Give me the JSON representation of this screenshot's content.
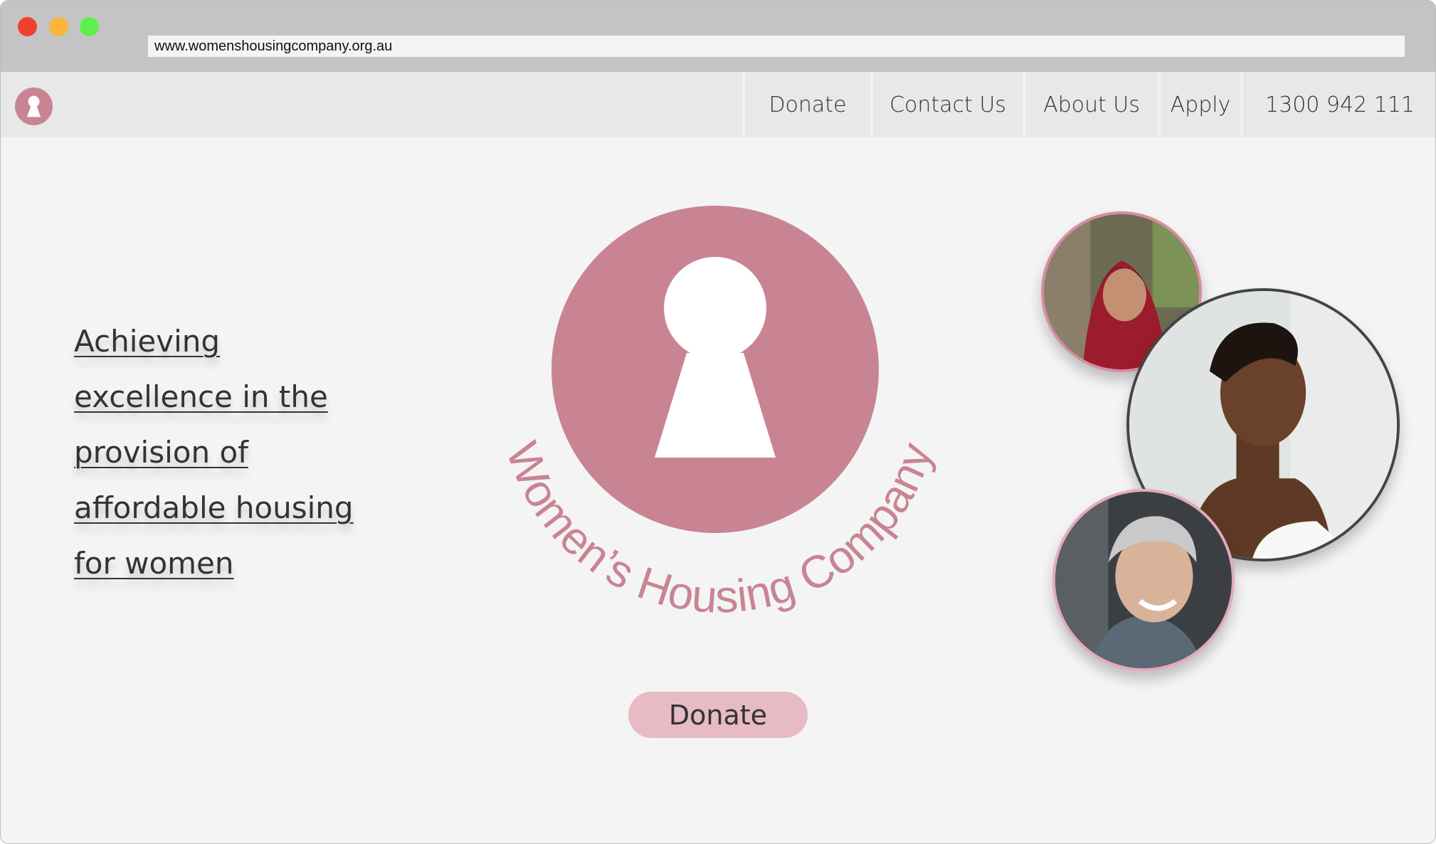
{
  "browser": {
    "url": "www.womenshousingcompany.org.au"
  },
  "nav": {
    "items": [
      {
        "label": "Donate"
      },
      {
        "label": "Contact Us"
      },
      {
        "label": "About Us"
      },
      {
        "label": "Apply"
      },
      {
        "label": "1300 942 111"
      }
    ]
  },
  "hero": {
    "tagline_lines": [
      "Achieving",
      "excellence in the",
      "provision of",
      "affordable housing",
      "for women"
    ],
    "brand_name": "Women’s Housing Company",
    "donate_label": "Donate"
  },
  "colors": {
    "brand_pink": "#c98494",
    "button_pink": "#e7bac5"
  },
  "icons": {
    "nav_logo": "keyhole-logo-icon",
    "main_logo": "keyhole-logo-icon"
  }
}
